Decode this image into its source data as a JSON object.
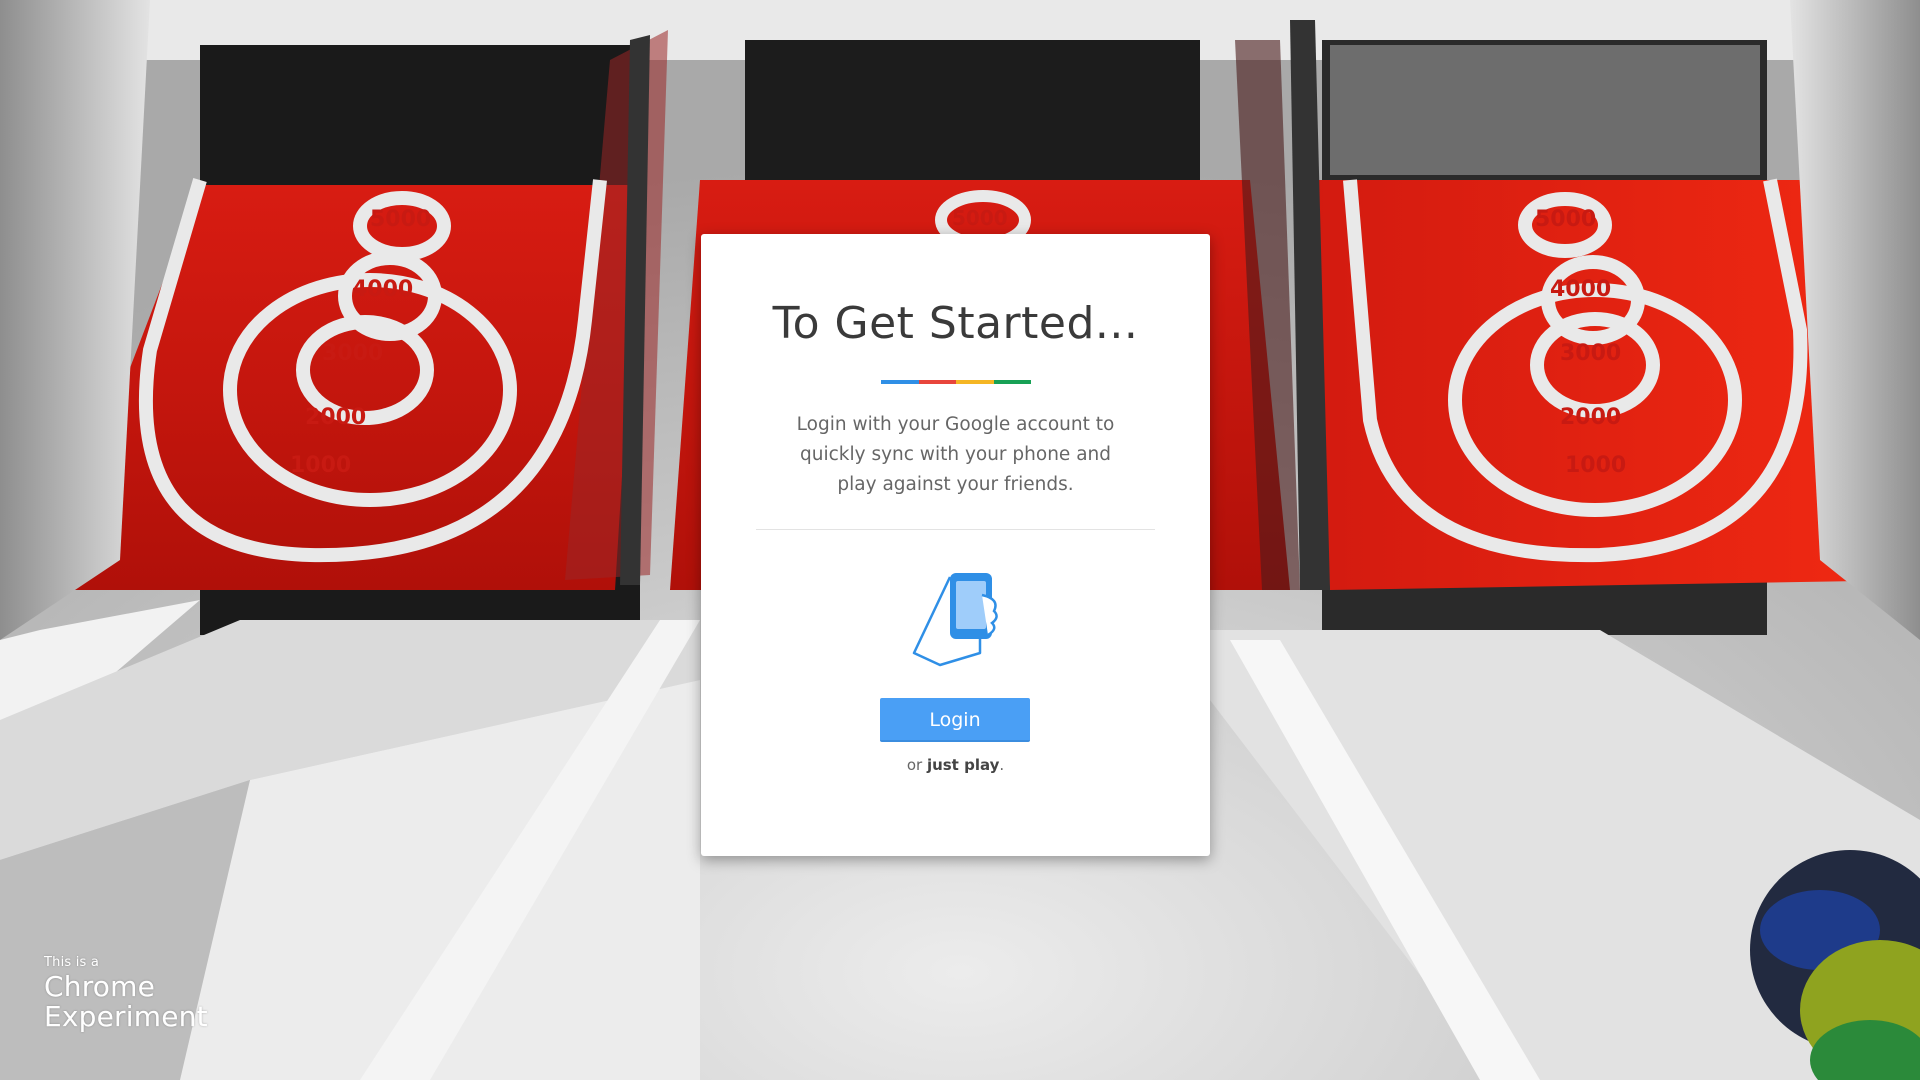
{
  "modal": {
    "title": "To Get Started...",
    "description": "Login with your Google account to quickly sync with your phone and play against your friends.",
    "login_label": "Login",
    "alt_prefix": "or ",
    "alt_link": "just play",
    "alt_suffix": ".",
    "accent_colors": [
      "#2f8fe6",
      "#e8453c",
      "#f5b624",
      "#17a155"
    ]
  },
  "scene": {
    "lanes": [
      {
        "scores": [
          "5000",
          "4000",
          "3000",
          "2000",
          "1000"
        ]
      },
      {
        "scores": [
          "5000"
        ]
      },
      {
        "scores": [
          "5000",
          "4000",
          "3000",
          "2000",
          "1000"
        ]
      }
    ]
  },
  "badge": {
    "small": "This is a",
    "line1": "Chrome",
    "line2": "Experiment"
  }
}
